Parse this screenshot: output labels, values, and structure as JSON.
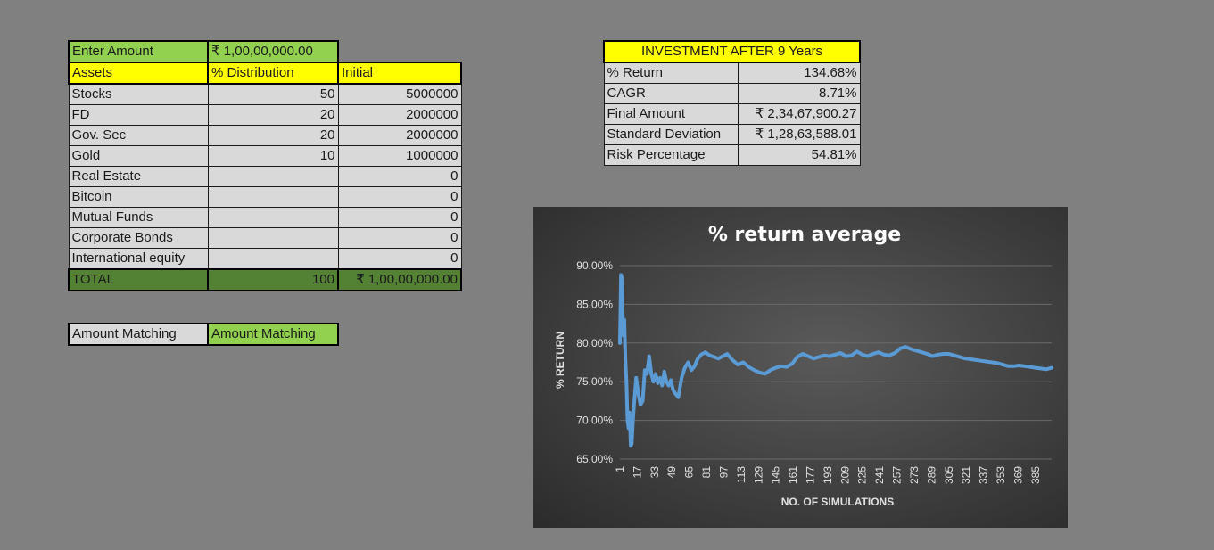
{
  "allocation": {
    "enter_amount_label": "Enter Amount",
    "enter_amount_value": "₹   1,00,00,000.00",
    "headers": [
      "Assets",
      "% Distribution",
      "Initial"
    ],
    "rows": [
      {
        "asset": "Stocks",
        "dist": "50",
        "initial": "5000000"
      },
      {
        "asset": "FD",
        "dist": "20",
        "initial": "2000000"
      },
      {
        "asset": "Gov. Sec",
        "dist": "20",
        "initial": "2000000"
      },
      {
        "asset": "Gold",
        "dist": "10",
        "initial": "1000000"
      },
      {
        "asset": "Real Estate",
        "dist": "",
        "initial": "0"
      },
      {
        "asset": "Bitcoin",
        "dist": "",
        "initial": "0"
      },
      {
        "asset": "Mutual Funds",
        "dist": "",
        "initial": "0"
      },
      {
        "asset": "Corporate Bonds",
        "dist": "",
        "initial": "0"
      },
      {
        "asset": "International equity",
        "dist": "",
        "initial": "0"
      }
    ],
    "total_label": "TOTAL",
    "total_dist": "100",
    "total_initial": "₹ 1,00,00,000.00"
  },
  "matching": {
    "label": "Amount Matching",
    "value": "Amount Matching"
  },
  "investment": {
    "title": "INVESTMENT AFTER 9 Years",
    "rows": [
      {
        "label": "% Return",
        "value": "134.68%"
      },
      {
        "label": "CAGR",
        "value": "8.71%"
      },
      {
        "label": "Final Amount",
        "value": "₹ 2,34,67,900.27"
      },
      {
        "label": "Standard Deviation",
        "value": "₹ 1,28,63,588.01"
      },
      {
        "label": "Risk Percentage",
        "value": "54.81%"
      }
    ]
  },
  "colors": {
    "background": "#808080",
    "header_yellow": "#ffff00",
    "input_green": "#92d050",
    "total_green": "#548235",
    "cell_gray": "#d9d9d9",
    "series_blue": "#5b9bd5"
  },
  "chart_data": {
    "type": "line",
    "title": "% return average",
    "xlabel": "NO. OF SIMULATIONS",
    "ylabel": "% RETURN",
    "ylim": [
      65,
      90
    ],
    "y_ticks": [
      "65.00%",
      "70.00%",
      "75.00%",
      "80.00%",
      "85.00%",
      "90.00%"
    ],
    "x_ticks": [
      "1",
      "17",
      "33",
      "49",
      "65",
      "81",
      "97",
      "113",
      "129",
      "145",
      "161",
      "177",
      "193",
      "209",
      "225",
      "241",
      "257",
      "273",
      "289",
      "305",
      "321",
      "337",
      "353",
      "369",
      "385"
    ],
    "grid": true,
    "legend": "none",
    "series": [
      {
        "x": [
          1,
          2,
          3,
          4,
          5,
          6,
          7,
          8,
          9,
          10,
          11,
          12,
          13,
          14,
          16,
          18,
          20,
          22,
          24,
          26,
          28,
          30,
          32,
          34,
          36,
          38,
          40,
          42,
          44,
          46,
          48,
          50,
          52,
          55,
          58,
          61,
          64,
          67,
          70,
          73,
          76,
          80,
          84,
          88,
          92,
          96,
          100,
          105,
          110,
          115,
          120,
          125,
          130,
          135,
          140,
          145,
          150,
          155,
          160,
          165,
          170,
          175,
          180,
          185,
          190,
          195,
          200,
          205,
          210,
          215,
          220,
          225,
          230,
          235,
          240,
          245,
          250,
          255,
          260,
          265,
          270,
          275,
          280,
          285,
          290,
          295,
          300,
          305,
          310,
          315,
          320,
          325,
          330,
          335,
          340,
          345,
          350,
          355,
          360,
          365,
          370,
          375,
          380,
          385,
          390,
          395,
          400
        ],
        "y": [
          80.0,
          88.8,
          88.4,
          81.0,
          83.0,
          78.0,
          75.0,
          70.0,
          69.0,
          71.0,
          66.7,
          67.0,
          70.0,
          72.0,
          75.5,
          73.5,
          72.0,
          72.5,
          76.5,
          76.0,
          78.3,
          76.0,
          75.0,
          76.0,
          74.8,
          75.5,
          74.5,
          76.3,
          75.0,
          74.5,
          75.2,
          74.0,
          73.5,
          73.0,
          75.5,
          76.8,
          77.5,
          76.5,
          77.0,
          78.0,
          78.5,
          78.8,
          78.4,
          78.2,
          78.0,
          78.3,
          78.6,
          77.8,
          77.2,
          77.5,
          76.9,
          76.5,
          76.2,
          76.0,
          76.5,
          76.8,
          77.0,
          76.9,
          77.3,
          78.2,
          78.6,
          78.3,
          78.0,
          78.2,
          78.4,
          78.3,
          78.5,
          78.7,
          78.3,
          78.4,
          78.9,
          78.5,
          78.3,
          78.6,
          78.8,
          78.5,
          78.4,
          78.7,
          79.3,
          79.5,
          79.2,
          79.0,
          78.8,
          78.6,
          78.3,
          78.5,
          78.6,
          78.6,
          78.4,
          78.2,
          78.0,
          77.9,
          77.8,
          77.7,
          77.6,
          77.5,
          77.4,
          77.2,
          77.0,
          77.0,
          77.1,
          77.0,
          76.9,
          76.8,
          76.7,
          76.6,
          76.8
        ]
      }
    ]
  }
}
